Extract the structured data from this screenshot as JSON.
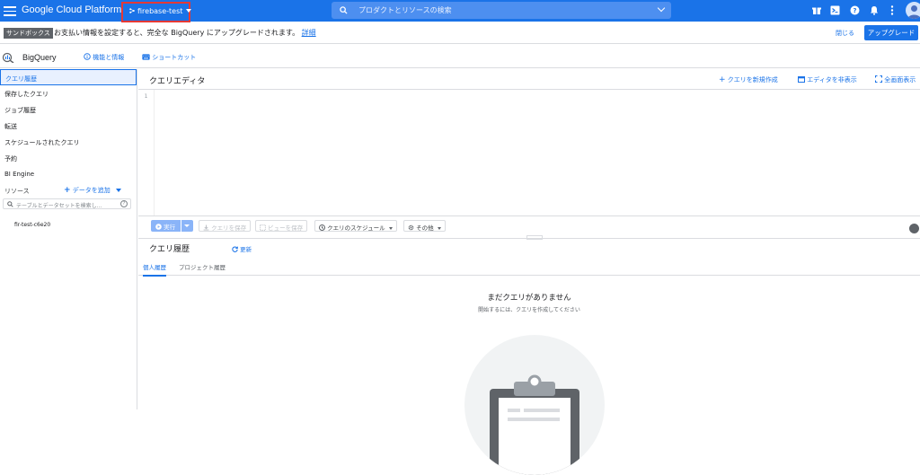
{
  "topbar": {
    "brand": "Google Cloud Platform",
    "project": "firebase-test",
    "search_placeholder": "プロダクトとリソースの検索"
  },
  "banner": {
    "badge": "サンドボックス",
    "message": "お支払い情報を設定すると、完全な BigQuery にアップグレードされます。",
    "link": "詳細",
    "close": "閉じる",
    "upgrade": "アップグレード"
  },
  "bq": {
    "title": "BigQuery",
    "info_link": "機能と情報",
    "shortcut_link": "ショートカット"
  },
  "sidebar": {
    "items": [
      {
        "label": "クエリ履歴"
      },
      {
        "label": "保存したクエリ"
      },
      {
        "label": "ジョブ履歴"
      },
      {
        "label": "転送"
      },
      {
        "label": "スケジュールされたクエリ"
      },
      {
        "label": "予約"
      },
      {
        "label": "BI Engine"
      }
    ],
    "resources_label": "リソース",
    "add_data": "データを追加",
    "search_placeholder": "テーブルとデータセットを検索し...",
    "project_item": "fir-test-c6e20"
  },
  "editor": {
    "title": "クエリエディタ",
    "new_query": "クエリを新規作成",
    "hide_editor": "エディタを非表示",
    "fullscreen": "全画面表示",
    "line_number": "1"
  },
  "toolbar": {
    "run": "実行",
    "save_query": "クエリを保存",
    "save_view": "ビューを保存",
    "schedule": "クエリのスケジュール",
    "more": "その他"
  },
  "history": {
    "title": "クエリ履歴",
    "refresh": "更新",
    "tabs": [
      {
        "label": "個人履歴"
      },
      {
        "label": "プロジェクト履歴"
      }
    ],
    "empty_title": "まだクエリがありません",
    "empty_sub": "開始するには、クエリを作成してください"
  },
  "colors": {
    "brand_blue": "#1a73e8",
    "highlight_red": "#e53935"
  }
}
